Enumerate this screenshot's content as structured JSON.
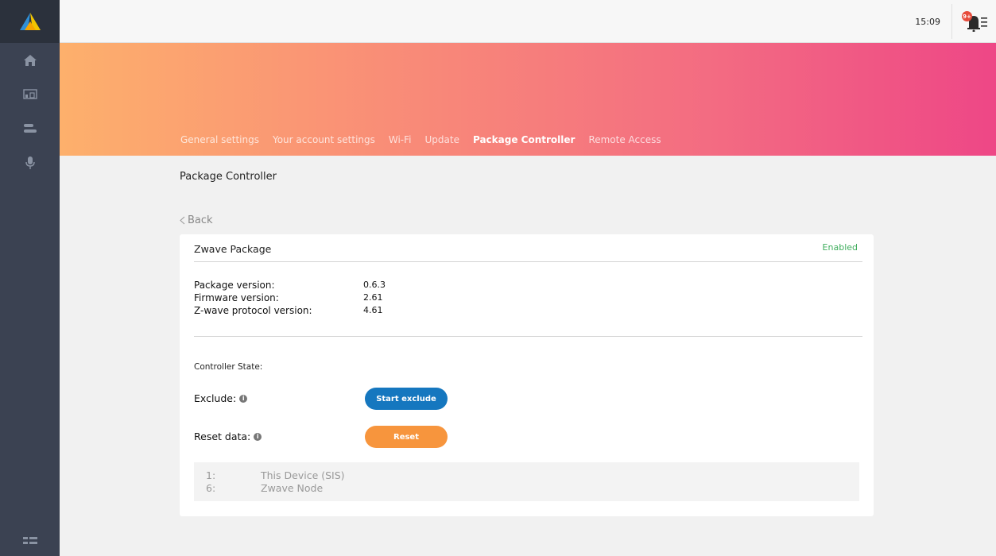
{
  "sidebar": {
    "logo": "app-logo",
    "items": [
      {
        "icon": "home-icon"
      },
      {
        "icon": "devices-icon"
      },
      {
        "icon": "controller-icon"
      },
      {
        "icon": "microphone-icon"
      }
    ],
    "bottom_icon": "menu-grid-icon"
  },
  "topbar": {
    "time": "15:09",
    "notification_count": "9+"
  },
  "tabs": [
    {
      "label": "General settings",
      "active": false
    },
    {
      "label": "Your account settings",
      "active": false
    },
    {
      "label": "Wi-Fi",
      "active": false
    },
    {
      "label": "Update",
      "active": false
    },
    {
      "label": "Package Controller",
      "active": true
    },
    {
      "label": "Remote Access",
      "active": false
    }
  ],
  "page": {
    "title": "Package Controller",
    "back_label": "Back"
  },
  "card": {
    "title": "Zwave Package",
    "status": "Enabled",
    "info": [
      {
        "label": "Package version:",
        "value": "0.6.3"
      },
      {
        "label": "Firmware version:",
        "value": "2.61"
      },
      {
        "label": "Z-wave protocol version:",
        "value": "4.61"
      }
    ],
    "controller_state_label": "Controller State:",
    "exclude_label": "Exclude:",
    "exclude_button": "Start exclude",
    "reset_label": "Reset data:",
    "reset_button": "Reset",
    "nodes": [
      {
        "index": "1:",
        "name": "This Device (SIS)"
      },
      {
        "index": "6:",
        "name": "Zwave Node"
      }
    ]
  },
  "colors": {
    "sidebar": "#3b4252",
    "accent_blue": "#1577bf",
    "accent_orange": "#f7953d",
    "enabled_green": "#3fae5d"
  }
}
